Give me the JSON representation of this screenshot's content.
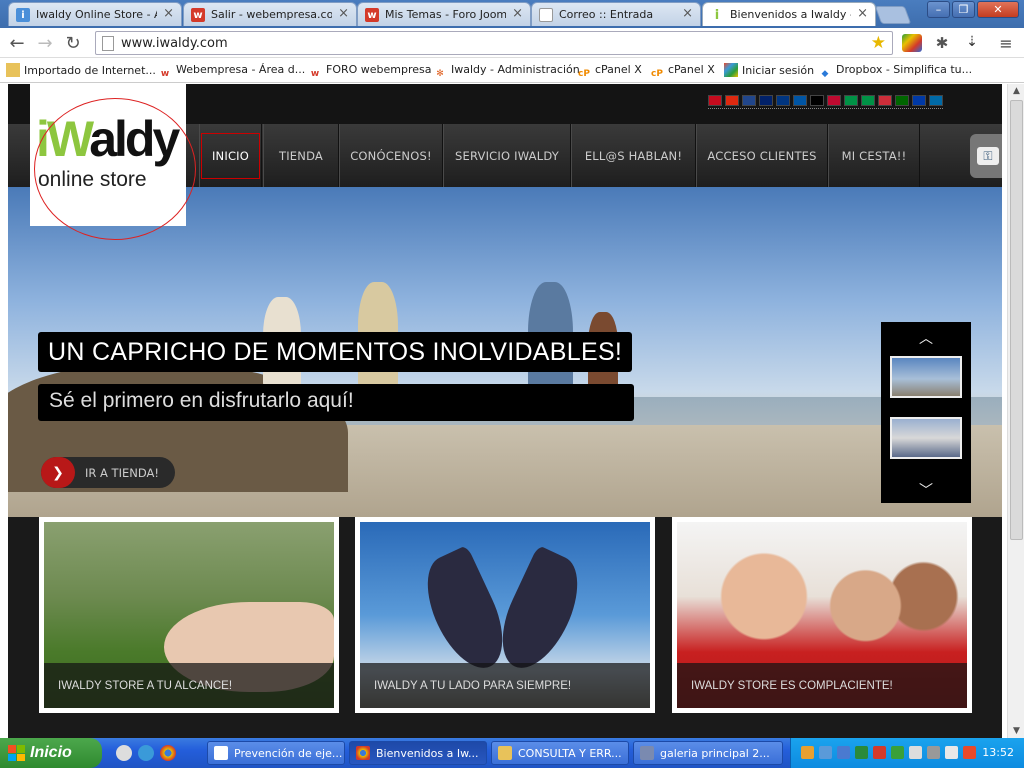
{
  "browser": {
    "tabs": [
      {
        "label": "Iwaldy Online Store - Ad",
        "fav_color": "#4a8fd9",
        "fav_glyph": "i"
      },
      {
        "label": "Salir - webempresa.com",
        "fav_color": "#d43a2a",
        "fav_glyph": "w"
      },
      {
        "label": "Mis Temas - Foro Joomla",
        "fav_color": "#d43a2a",
        "fav_glyph": "w"
      },
      {
        "label": "Correo :: Entrada",
        "fav_color": "#ffffff",
        "fav_glyph": ""
      },
      {
        "label": "Bienvenidos a Iwaldy - Iw",
        "fav_color": "#8dc63f",
        "fav_glyph": "i"
      }
    ],
    "close_glyph": "×",
    "window_buttons": [
      "–",
      "❐",
      "✕"
    ],
    "url": "www.iwaldy.com",
    "bookmarks": [
      {
        "label": "Importado de Internet...",
        "icon": "folder-icon",
        "color": "#e8c25a"
      },
      {
        "label": "Webempresa - Área d...",
        "icon": "webempresa-icon",
        "color": "#d43a2a"
      },
      {
        "label": "FORO webempresa",
        "icon": "webempresa-icon",
        "color": "#d43a2a"
      },
      {
        "label": "Iwaldy - Administración",
        "icon": "joomla-icon",
        "color": "#e06020"
      },
      {
        "label": "cPanel X",
        "icon": "cpanel-icon",
        "color": "#f08a00"
      },
      {
        "label": "cPanel X",
        "icon": "cpanel-icon",
        "color": "#f08a00"
      },
      {
        "label": "Iniciar sesión",
        "icon": "windows-live-icon",
        "color": "#3a9ad9"
      },
      {
        "label": "Dropbox - Simplifica tu...",
        "icon": "dropbox-icon",
        "color": "#2a7ad9"
      }
    ]
  },
  "site": {
    "logo": {
      "w_green": "iW",
      "w_rest": "aldy",
      "subtitle": "online store"
    },
    "nav": [
      "INICIO",
      "TIENDA",
      "CONÓCENOS!",
      "SERVICIO IWALDY",
      "ELL@S HABLAN!",
      "ACCESO CLIENTES",
      "MI CESTA!!"
    ],
    "active_nav": "INICIO",
    "flags": [
      "#c60b1e",
      "#de2910",
      "#21468b",
      "#012169",
      "#003580",
      "#0055a4",
      "#000000",
      "#bf0a30",
      "#009246",
      "#009246",
      "#cd2e3a",
      "#006600",
      "#0039a6",
      "#006aa7"
    ],
    "hero": {
      "caption_title": "UN CAPRICHO DE MOMENTOS INOLVIDABLES!",
      "caption_sub": "Sé el primero en disfrutarlo aquí!",
      "button_label": "IR A TIENDA!",
      "button_arrow": "❯"
    },
    "slider_up": "︿",
    "slider_down": "﹀",
    "cards": [
      {
        "caption": "IWALDY STORE A TU ALCANCE!"
      },
      {
        "caption": "IWALDY A TU LADO PARA SIEMPRE!"
      },
      {
        "caption": "IWALDY STORE ES COMPLACIENTE!"
      }
    ]
  },
  "taskbar": {
    "start_label": "Inicio",
    "items": [
      {
        "label": "Prevención de eje...",
        "color": "#ffffff"
      },
      {
        "label": "Bienvenidos a Iw...",
        "color": "#e8b800"
      },
      {
        "label": "CONSULTA Y ERR...",
        "color": "#e8c25a"
      },
      {
        "label": "galeria principal 2...",
        "color": "#7a8ab0"
      }
    ],
    "clock": "13:52"
  }
}
